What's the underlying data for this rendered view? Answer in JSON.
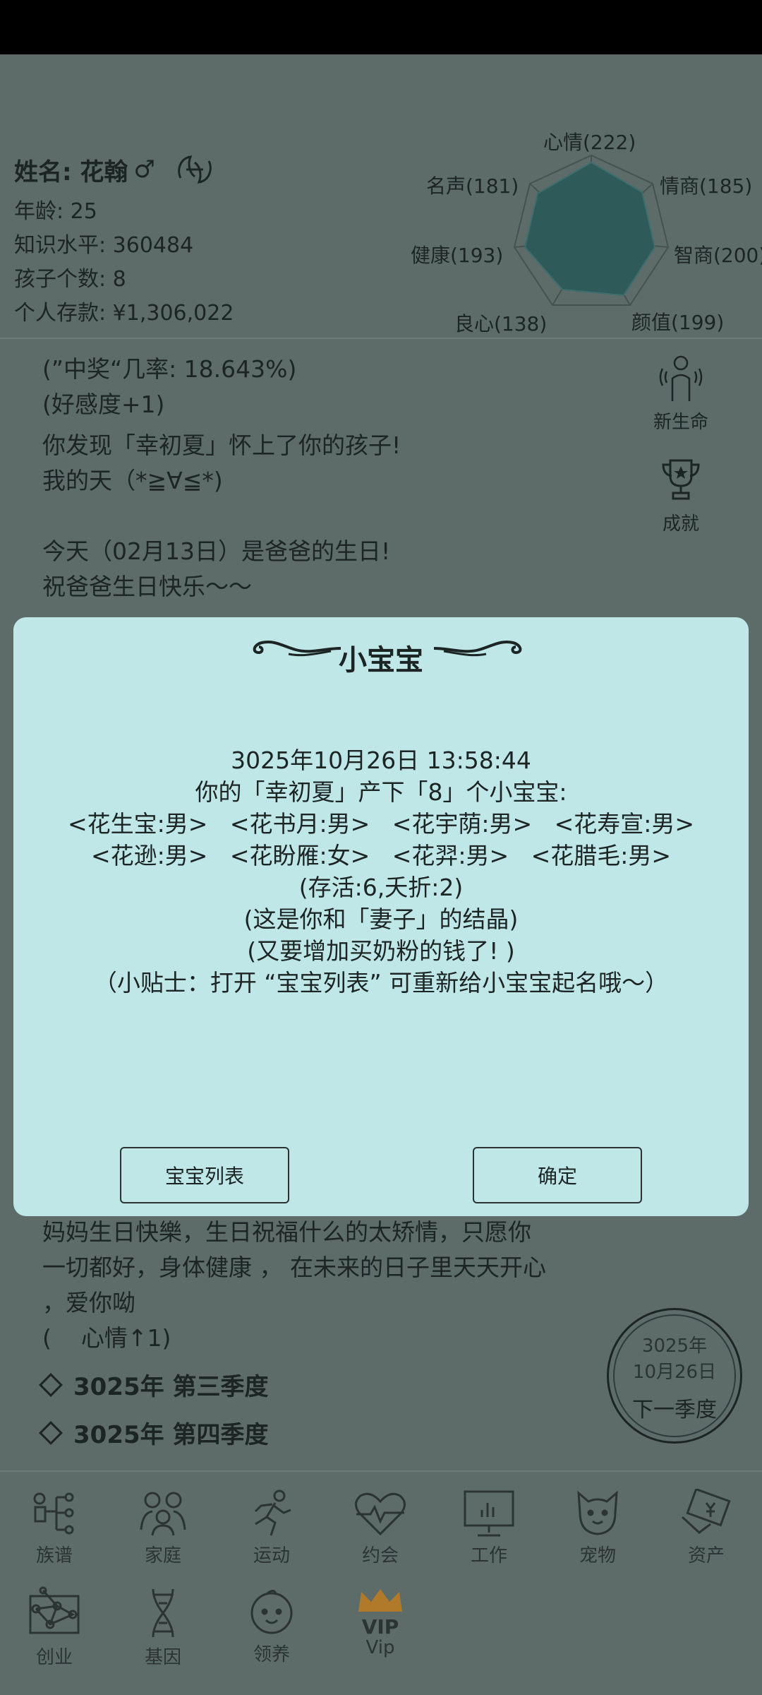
{
  "profile": {
    "name_label": "姓名: 花翰",
    "gender_symbol": "♂",
    "age": "年龄: 25",
    "knowledge": "知识水平: 360484",
    "children": "孩子个数: 8",
    "savings": "个人存款: ¥1,306,022",
    "zodiac_icon": "pisces-icon"
  },
  "radar": {
    "labels": [
      "心情(222)",
      "情商(185)",
      "智商(200)",
      "颜值(199)",
      "良心(138)",
      "健康(193)",
      "名声(181)"
    ]
  },
  "log_top": [
    "(”中奖“几率: 18.643%)",
    "(好感度+1)",
    "你发现「幸初夏」怀上了你的孩子!",
    "我的天（*≧∀≦*)",
    "",
    "今天（02月13日）是爸爸的生日!",
    "祝爸爸生日快乐～～"
  ],
  "side": {
    "new_life": "新生命",
    "achievement": "成就"
  },
  "dialog": {
    "title": "小宝宝",
    "lines": [
      "3025年10月26日 13:58:44",
      "你的「幸初夏」产下「8」个小宝宝:",
      "<花生宝:男>   <花书月:男>   <花宇荫:男>   <花寿宣:男>",
      "<花逊:男>   <花盼雁:女>   <花羿:男>   <花腊毛:男>",
      "(存活:6,夭折:2)",
      "(这是你和「妻子」的结晶)",
      "(又要增加买奶粉的钱了! )",
      "（小贴士：打开 “宝宝列表” 可重新给小宝宝起名哦～）"
    ],
    "btn_list": "宝宝列表",
    "btn_ok": "确定"
  },
  "log_bottom": [
    "妈妈生日快樂，生日祝福什么的太矫情，只愿你",
    "一切都好，身体健康 ，  在未来的日子里天天开心",
    "，爱你呦",
    "(    心情↑1)"
  ],
  "seasons": [
    "3025年 第三季度",
    "3025年 第四季度"
  ],
  "date_badge": {
    "year": "3025年",
    "date": "10月26日",
    "action": "下一季度"
  },
  "nav_row1": [
    "族谱",
    "家庭",
    "运动",
    "约会",
    "工作",
    "宠物",
    "资产"
  ],
  "nav_row2": [
    "创业",
    "基因",
    "领养",
    "VIP",
    "Vip"
  ],
  "colors": {
    "dialog_bg": "#bfe7e8",
    "page_bg": "#5d6b69",
    "vip": "#c0392b"
  }
}
